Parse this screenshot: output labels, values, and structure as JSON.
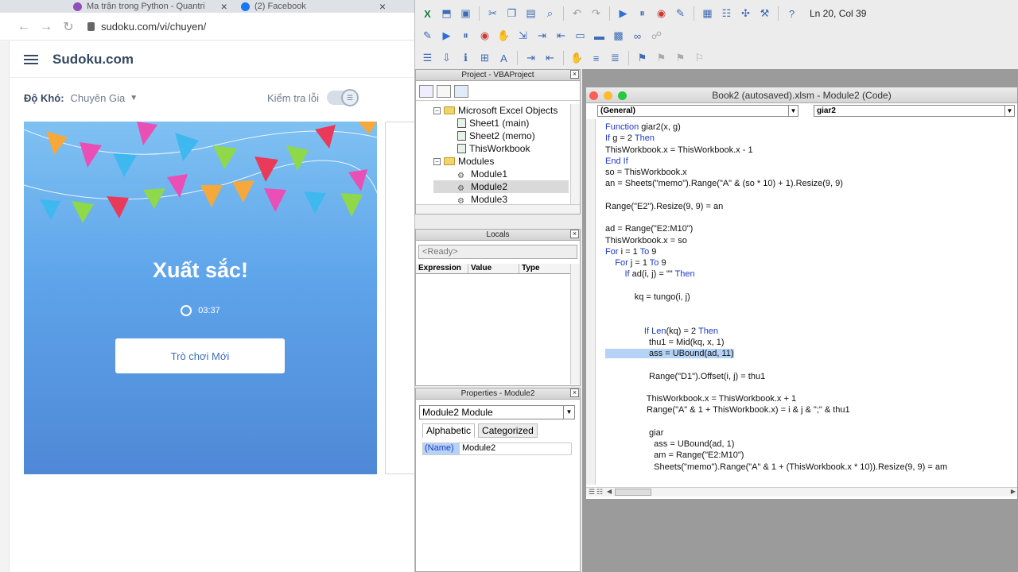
{
  "browser": {
    "tabs": [
      {
        "label": "Ma trận trong Python - Quantri",
        "icon": "quantri-icon"
      },
      {
        "label": "(2) Facebook",
        "icon": "facebook-icon"
      }
    ],
    "url": "sudoku.com/vi/chuyen/",
    "site": {
      "logo": "Sudoku.com",
      "difficulty_label": "Độ Khó:",
      "difficulty_value": "Chuyên Gia",
      "check_label": "Kiểm tra lỗi",
      "win_title": "Xuất sắc!",
      "time": "03:37",
      "new_game": "Trò chơi Mới"
    }
  },
  "vbe": {
    "status": "Ln 20, Col 39",
    "project": {
      "title": "Project - VBAProject",
      "items": [
        {
          "label": "Microsoft Excel Objects",
          "kind": "folder"
        },
        {
          "label": "Sheet1 (main)",
          "kind": "sheet"
        },
        {
          "label": "Sheet2 (memo)",
          "kind": "sheet"
        },
        {
          "label": "ThisWorkbook",
          "kind": "sheet"
        },
        {
          "label": "Modules",
          "kind": "folder"
        },
        {
          "label": "Module1",
          "kind": "module"
        },
        {
          "label": "Module2",
          "kind": "module"
        },
        {
          "label": "Module3",
          "kind": "module"
        }
      ]
    },
    "locals": {
      "title": "Locals",
      "ready": "<Ready>",
      "columns": [
        "Expression",
        "Value",
        "Type"
      ]
    },
    "properties": {
      "title": "Properties - Module2",
      "object": "Module2  Module",
      "tabs": [
        "Alphabetic",
        "Categorized"
      ],
      "name_key": "(Name)",
      "name_value": "Module2"
    },
    "code_window": {
      "title": "Book2 (autosaved).xlsm - Module2 (Code)",
      "object_combo": "(General)",
      "proc_combo": "giar2",
      "lines": [
        "Function giar2(x, g)",
        "If g = 2 Then",
        "ThisWorkbook.x = ThisWorkbook.x - 1",
        "End If",
        "so = ThisWorkbook.x",
        "an = Sheets(\"memo\").Range(\"A\" & (so * 10) + 1).Resize(9, 9)",
        "",
        "Range(\"E2\").Resize(9, 9) = an",
        "",
        "ad = Range(\"E2:M10\")",
        "ThisWorkbook.x = so",
        "For i = 1 To 9",
        "    For j = 1 To 9",
        "        If ad(i, j) = \"\" Then",
        "",
        "            kq = tungo(i, j)",
        "",
        "",
        "                If Len(kq) = 2 Then",
        "                  thu1 = Mid(kq, x, 1)",
        "                  ass = UBound(ad, 11)",
        "",
        "                  Range(\"D1\").Offset(i, j) = thu1",
        "",
        "                 ThisWorkbook.x = ThisWorkbook.x + 1",
        "                 Range(\"A\" & 1 + ThisWorkbook.x) = i & j & \";\" & thu1",
        "",
        "                  giar",
        "                    ass = UBound(ad, 1)",
        "                    am = Range(\"E2:M10\")",
        "                    Sheets(\"memo\").Range(\"A\" & 1 + (ThisWorkbook.x * 10)).Resize(9, 9) = am"
      ],
      "selected_line": 20
    }
  },
  "colors": {
    "board_top": "#7fc1f2",
    "board_bottom": "#4f88d6",
    "keyword": "#1d39c4",
    "selection": "#b5d3f7"
  }
}
